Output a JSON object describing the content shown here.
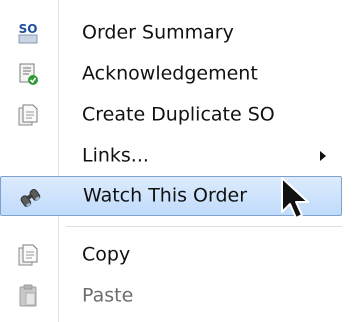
{
  "menu": {
    "items": [
      {
        "label": "Order Summary",
        "icon": "so-icon",
        "so_text": "SO"
      },
      {
        "label": "Acknowledgement",
        "icon": "acknowledgement-icon"
      },
      {
        "label": "Create Duplicate SO",
        "icon": "duplicate-document-icon"
      },
      {
        "label": "Links...",
        "icon": "",
        "has_submenu": true
      },
      {
        "label": "Watch This Order",
        "icon": "binoculars-icon",
        "highlighted": true
      },
      {
        "label": "Copy",
        "icon": "copy-icon"
      },
      {
        "label": "Paste",
        "icon": "paste-icon",
        "disabled": true
      }
    ]
  },
  "colors": {
    "highlight_top": "#dcebfc",
    "highlight_bottom": "#c1dbfc",
    "highlight_border": "#7da2ce",
    "so_blue": "#1f4fa0",
    "check_green": "#2e9a35"
  }
}
